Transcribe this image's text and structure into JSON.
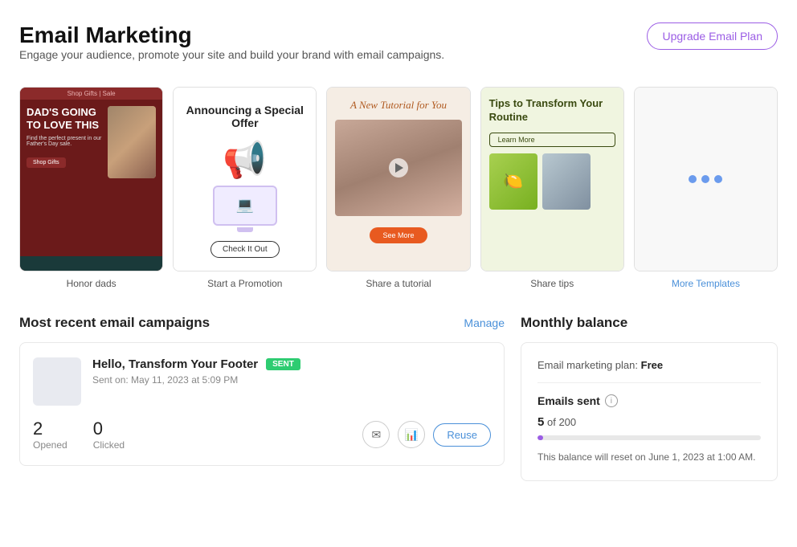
{
  "page": {
    "title": "Email Marketing",
    "subtitle": "Engage your audience, promote your site and build your brand with email campaigns.",
    "upgrade_btn": "Upgrade Email Plan"
  },
  "templates": [
    {
      "id": "honor-dads",
      "label": "Honor dads",
      "type": "image",
      "topbar": "Shop Gifts | Sale",
      "heading": "DAD'S GOING TO LOVE THIS",
      "body": "Find the perfect present in our Father's Day sale.",
      "cta": "Shop Gifts"
    },
    {
      "id": "start-promotion",
      "label": "Start a Promotion",
      "type": "promo",
      "heading": "Announcing a Special Offer",
      "cta": "Check It Out"
    },
    {
      "id": "share-tutorial",
      "label": "Share a tutorial",
      "type": "tutorial",
      "heading": "A New Tutorial for You",
      "cta": "See More"
    },
    {
      "id": "share-tips",
      "label": "Share tips",
      "type": "tips",
      "heading": "Tips to Transform Your Routine",
      "cta": "Learn More"
    },
    {
      "id": "more-templates",
      "label": "More Templates",
      "type": "more"
    }
  ],
  "campaigns": {
    "section_title": "Most recent email campaigns",
    "manage_label": "Manage",
    "items": [
      {
        "title": "Hello, Transform Your Footer",
        "status": "SENT",
        "date": "Sent on: May 11, 2023 at 5:09 PM",
        "opened": "2",
        "opened_label": "Opened",
        "clicked": "0",
        "clicked_label": "Clicked",
        "reuse_label": "Reuse"
      }
    ]
  },
  "balance": {
    "section_title": "Monthly balance",
    "plan_label": "Email marketing plan:",
    "plan_name": "Free",
    "emails_sent_label": "Emails sent",
    "sent_count": "5",
    "sent_total": "200",
    "sent_display": "5 of 200",
    "progress_percent": 2.5,
    "reset_note": "This balance will reset on June 1, 2023 at 1:00 AM."
  },
  "icons": {
    "email": "✉",
    "chart": "📊",
    "info": "i"
  }
}
